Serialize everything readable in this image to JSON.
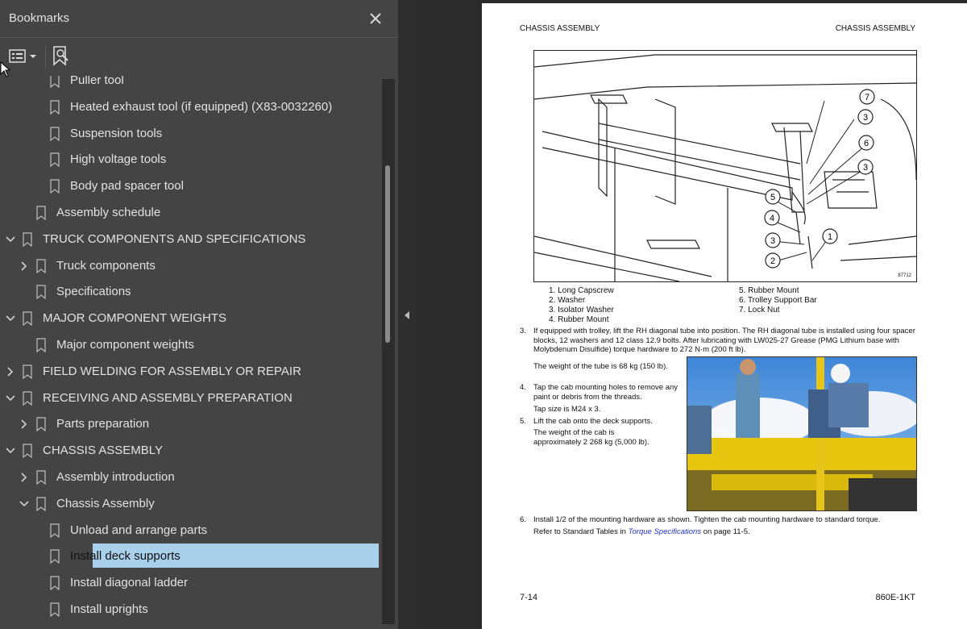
{
  "bookmarks": {
    "title": "Bookmarks",
    "close_icon": "close-icon",
    "options_icon": "list-options-icon",
    "find_icon": "find-bookmark-icon",
    "items": [
      {
        "label": "Puller tool",
        "level": 2,
        "expander": "none"
      },
      {
        "label": "Heated exhaust tool (if equipped) (X83-0032260)",
        "level": 2,
        "expander": "none"
      },
      {
        "label": "Suspension tools",
        "level": 2,
        "expander": "none"
      },
      {
        "label": "High voltage tools",
        "level": 2,
        "expander": "none"
      },
      {
        "label": "Body pad spacer tool",
        "level": 2,
        "expander": "none"
      },
      {
        "label": "Assembly schedule",
        "level": 1,
        "expander": "none"
      },
      {
        "label": "TRUCK COMPONENTS AND SPECIFICATIONS",
        "level": 0,
        "expander": "expanded"
      },
      {
        "label": "Truck components",
        "level": 1,
        "expander": "collapsed"
      },
      {
        "label": "Specifications",
        "level": 1,
        "expander": "none"
      },
      {
        "label": "MAJOR COMPONENT WEIGHTS",
        "level": 0,
        "expander": "expanded"
      },
      {
        "label": "Major component weights",
        "level": 1,
        "expander": "none"
      },
      {
        "label": "FIELD WELDING FOR ASSEMBLY OR REPAIR",
        "level": 0,
        "expander": "collapsed"
      },
      {
        "label": "RECEIVING AND ASSEMBLY PREPARATION",
        "level": 0,
        "expander": "expanded"
      },
      {
        "label": "Parts preparation",
        "level": 1,
        "expander": "collapsed"
      },
      {
        "label": "CHASSIS ASSEMBLY",
        "level": 0,
        "expander": "expanded"
      },
      {
        "label": "Assembly introduction",
        "level": 1,
        "expander": "collapsed"
      },
      {
        "label": "Chassis Assembly",
        "level": 1,
        "expander": "expanded"
      },
      {
        "label": "Unload and arrange parts",
        "level": 2,
        "expander": "none"
      },
      {
        "label": "Install deck supports",
        "level": 2,
        "expander": "none",
        "selected": true
      },
      {
        "label": "Install diagonal ladder",
        "level": 2,
        "expander": "none"
      },
      {
        "label": "Install uprights",
        "level": 2,
        "expander": "none"
      }
    ]
  },
  "colors": {
    "selected": "#a9d0ea",
    "panel": "#444444",
    "link": "#2233cc"
  },
  "page": {
    "header_left": "CHASSIS ASSEMBLY",
    "header_right": "CHASSIS ASSEMBLY",
    "figure_number": "87712",
    "callouts": [
      "7",
      "3",
      "6",
      "3",
      "5",
      "4",
      "1",
      "3",
      "2"
    ],
    "legend_left": [
      "1.  Long Capscrew",
      "2.  Washer",
      "3.  Isolator Washer",
      "4.  Rubber Mount"
    ],
    "legend_right": [
      "5.  Rubber Mount",
      "6.  Trolley Support Bar",
      "7.  Lock Nut"
    ],
    "step3_num": "3.",
    "step3_text": "If equipped with trolley, lift the RH diagonal tube into position. The RH diagonal tube is installed using four spacer blocks, 12 washers and 12 class 12.9 bolts. After lubricating with LW025-27 Grease (PMG Lithium base with Molybdenum Disulfide) torque hardware to 272 N·m (200 ft lb).",
    "tube_weight": "The weight of the tube is 68 kg (150 lb).",
    "step4_num": "4.",
    "step4_text": "Tap the cab mounting holes to remove any paint or debris from the threads.",
    "tap_size": "Tap size is M24 x 3.",
    "step5_num": "5.",
    "step5_text": "Lift the cab onto the deck supports.",
    "cab_weight": "The weight of the cab is approximately 2 268 kg (5,000 lb).",
    "step6_num": "6.",
    "step6_text": "Install 1/2 of the mounting hardware as shown. Tighten the cab mounting hardware to standard torque.",
    "step6_ref_pre": "Refer to Standard Tables in ",
    "step6_ref_link": "Torque Specifications",
    "step6_ref_post": " on page 11-5.",
    "footer_left": "7-14",
    "footer_right": "860E-1KT"
  }
}
